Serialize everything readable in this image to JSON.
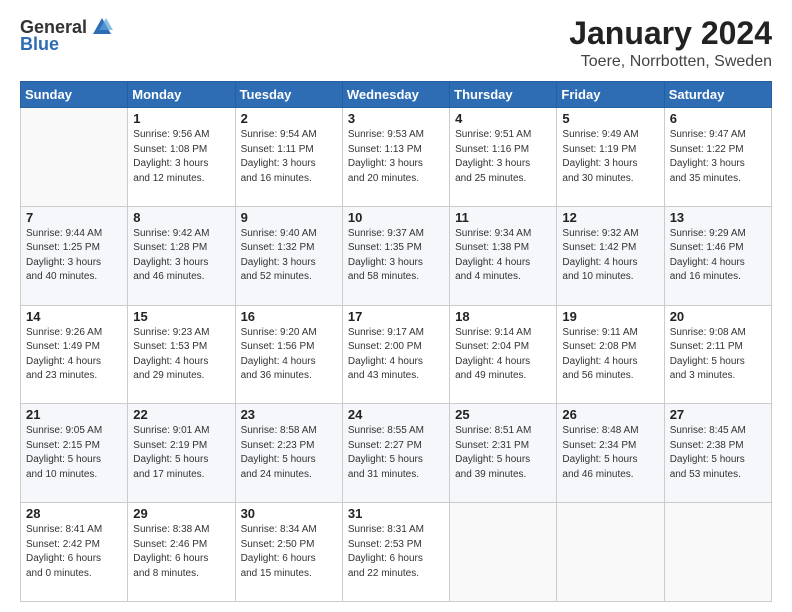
{
  "header": {
    "logo_general": "General",
    "logo_blue": "Blue",
    "title": "January 2024",
    "subtitle": "Toere, Norrbotten, Sweden"
  },
  "columns": [
    "Sunday",
    "Monday",
    "Tuesday",
    "Wednesday",
    "Thursday",
    "Friday",
    "Saturday"
  ],
  "weeks": [
    [
      {
        "day": "",
        "lines": []
      },
      {
        "day": "1",
        "lines": [
          "Sunrise: 9:56 AM",
          "Sunset: 1:08 PM",
          "Daylight: 3 hours",
          "and 12 minutes."
        ]
      },
      {
        "day": "2",
        "lines": [
          "Sunrise: 9:54 AM",
          "Sunset: 1:11 PM",
          "Daylight: 3 hours",
          "and 16 minutes."
        ]
      },
      {
        "day": "3",
        "lines": [
          "Sunrise: 9:53 AM",
          "Sunset: 1:13 PM",
          "Daylight: 3 hours",
          "and 20 minutes."
        ]
      },
      {
        "day": "4",
        "lines": [
          "Sunrise: 9:51 AM",
          "Sunset: 1:16 PM",
          "Daylight: 3 hours",
          "and 25 minutes."
        ]
      },
      {
        "day": "5",
        "lines": [
          "Sunrise: 9:49 AM",
          "Sunset: 1:19 PM",
          "Daylight: 3 hours",
          "and 30 minutes."
        ]
      },
      {
        "day": "6",
        "lines": [
          "Sunrise: 9:47 AM",
          "Sunset: 1:22 PM",
          "Daylight: 3 hours",
          "and 35 minutes."
        ]
      }
    ],
    [
      {
        "day": "7",
        "lines": [
          "Sunrise: 9:44 AM",
          "Sunset: 1:25 PM",
          "Daylight: 3 hours",
          "and 40 minutes."
        ]
      },
      {
        "day": "8",
        "lines": [
          "Sunrise: 9:42 AM",
          "Sunset: 1:28 PM",
          "Daylight: 3 hours",
          "and 46 minutes."
        ]
      },
      {
        "day": "9",
        "lines": [
          "Sunrise: 9:40 AM",
          "Sunset: 1:32 PM",
          "Daylight: 3 hours",
          "and 52 minutes."
        ]
      },
      {
        "day": "10",
        "lines": [
          "Sunrise: 9:37 AM",
          "Sunset: 1:35 PM",
          "Daylight: 3 hours",
          "and 58 minutes."
        ]
      },
      {
        "day": "11",
        "lines": [
          "Sunrise: 9:34 AM",
          "Sunset: 1:38 PM",
          "Daylight: 4 hours",
          "and 4 minutes."
        ]
      },
      {
        "day": "12",
        "lines": [
          "Sunrise: 9:32 AM",
          "Sunset: 1:42 PM",
          "Daylight: 4 hours",
          "and 10 minutes."
        ]
      },
      {
        "day": "13",
        "lines": [
          "Sunrise: 9:29 AM",
          "Sunset: 1:46 PM",
          "Daylight: 4 hours",
          "and 16 minutes."
        ]
      }
    ],
    [
      {
        "day": "14",
        "lines": [
          "Sunrise: 9:26 AM",
          "Sunset: 1:49 PM",
          "Daylight: 4 hours",
          "and 23 minutes."
        ]
      },
      {
        "day": "15",
        "lines": [
          "Sunrise: 9:23 AM",
          "Sunset: 1:53 PM",
          "Daylight: 4 hours",
          "and 29 minutes."
        ]
      },
      {
        "day": "16",
        "lines": [
          "Sunrise: 9:20 AM",
          "Sunset: 1:56 PM",
          "Daylight: 4 hours",
          "and 36 minutes."
        ]
      },
      {
        "day": "17",
        "lines": [
          "Sunrise: 9:17 AM",
          "Sunset: 2:00 PM",
          "Daylight: 4 hours",
          "and 43 minutes."
        ]
      },
      {
        "day": "18",
        "lines": [
          "Sunrise: 9:14 AM",
          "Sunset: 2:04 PM",
          "Daylight: 4 hours",
          "and 49 minutes."
        ]
      },
      {
        "day": "19",
        "lines": [
          "Sunrise: 9:11 AM",
          "Sunset: 2:08 PM",
          "Daylight: 4 hours",
          "and 56 minutes."
        ]
      },
      {
        "day": "20",
        "lines": [
          "Sunrise: 9:08 AM",
          "Sunset: 2:11 PM",
          "Daylight: 5 hours",
          "and 3 minutes."
        ]
      }
    ],
    [
      {
        "day": "21",
        "lines": [
          "Sunrise: 9:05 AM",
          "Sunset: 2:15 PM",
          "Daylight: 5 hours",
          "and 10 minutes."
        ]
      },
      {
        "day": "22",
        "lines": [
          "Sunrise: 9:01 AM",
          "Sunset: 2:19 PM",
          "Daylight: 5 hours",
          "and 17 minutes."
        ]
      },
      {
        "day": "23",
        "lines": [
          "Sunrise: 8:58 AM",
          "Sunset: 2:23 PM",
          "Daylight: 5 hours",
          "and 24 minutes."
        ]
      },
      {
        "day": "24",
        "lines": [
          "Sunrise: 8:55 AM",
          "Sunset: 2:27 PM",
          "Daylight: 5 hours",
          "and 31 minutes."
        ]
      },
      {
        "day": "25",
        "lines": [
          "Sunrise: 8:51 AM",
          "Sunset: 2:31 PM",
          "Daylight: 5 hours",
          "and 39 minutes."
        ]
      },
      {
        "day": "26",
        "lines": [
          "Sunrise: 8:48 AM",
          "Sunset: 2:34 PM",
          "Daylight: 5 hours",
          "and 46 minutes."
        ]
      },
      {
        "day": "27",
        "lines": [
          "Sunrise: 8:45 AM",
          "Sunset: 2:38 PM",
          "Daylight: 5 hours",
          "and 53 minutes."
        ]
      }
    ],
    [
      {
        "day": "28",
        "lines": [
          "Sunrise: 8:41 AM",
          "Sunset: 2:42 PM",
          "Daylight: 6 hours",
          "and 0 minutes."
        ]
      },
      {
        "day": "29",
        "lines": [
          "Sunrise: 8:38 AM",
          "Sunset: 2:46 PM",
          "Daylight: 6 hours",
          "and 8 minutes."
        ]
      },
      {
        "day": "30",
        "lines": [
          "Sunrise: 8:34 AM",
          "Sunset: 2:50 PM",
          "Daylight: 6 hours",
          "and 15 minutes."
        ]
      },
      {
        "day": "31",
        "lines": [
          "Sunrise: 8:31 AM",
          "Sunset: 2:53 PM",
          "Daylight: 6 hours",
          "and 22 minutes."
        ]
      },
      {
        "day": "",
        "lines": []
      },
      {
        "day": "",
        "lines": []
      },
      {
        "day": "",
        "lines": []
      }
    ]
  ]
}
